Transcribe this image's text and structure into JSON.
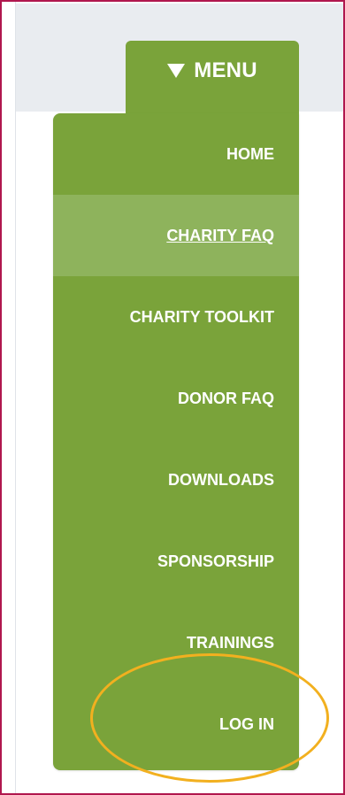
{
  "menu": {
    "toggle_label": "MENU",
    "items": [
      {
        "label": "HOME",
        "active": false
      },
      {
        "label": "CHARITY FAQ",
        "active": true
      },
      {
        "label": "CHARITY TOOLKIT",
        "active": false
      },
      {
        "label": "DONOR FAQ",
        "active": false
      },
      {
        "label": "DOWNLOADS",
        "active": false
      },
      {
        "label": "SPONSORSHIP",
        "active": false
      },
      {
        "label": "TRAININGS",
        "active": false
      },
      {
        "label": "LOG IN",
        "active": false
      }
    ]
  },
  "colors": {
    "menu_green": "#7aa33a",
    "active_green": "#8eb35c",
    "highlight_orange": "#f2b01f",
    "frame_border": "#b0174e",
    "header_gray": "#e9ecf0"
  }
}
